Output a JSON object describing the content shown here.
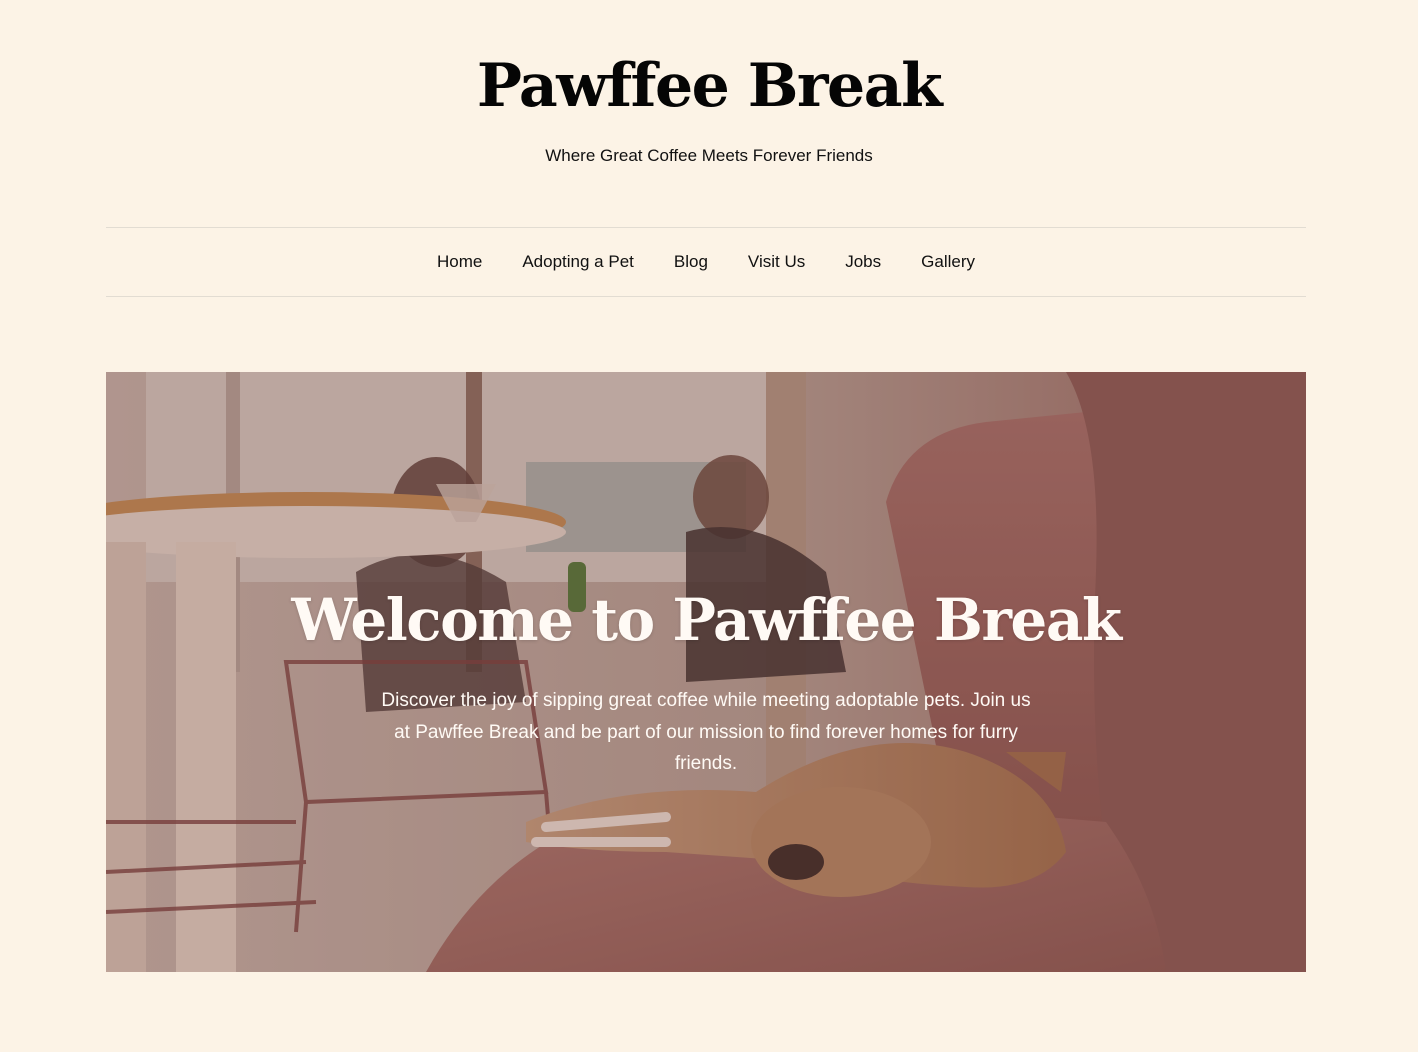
{
  "site": {
    "title": "Pawffee Break",
    "tagline": "Where Great Coffee Meets Forever Friends"
  },
  "nav": {
    "items": [
      {
        "label": "Home"
      },
      {
        "label": "Adopting a Pet"
      },
      {
        "label": "Blog"
      },
      {
        "label": "Visit Us"
      },
      {
        "label": "Jobs"
      },
      {
        "label": "Gallery"
      }
    ]
  },
  "hero": {
    "title": "Welcome to Pawffee Break",
    "text": "Discover the joy of sipping great coffee while meeting adoptable pets. Join us at Pawffee Break and be part of our mission to find forever homes for furry friends."
  },
  "colors": {
    "background": "#fcf3e6",
    "text": "#000000",
    "divider": "#e2dcd2",
    "hero_overlay": "#8a5a55",
    "hero_text": "#fffaf5"
  }
}
